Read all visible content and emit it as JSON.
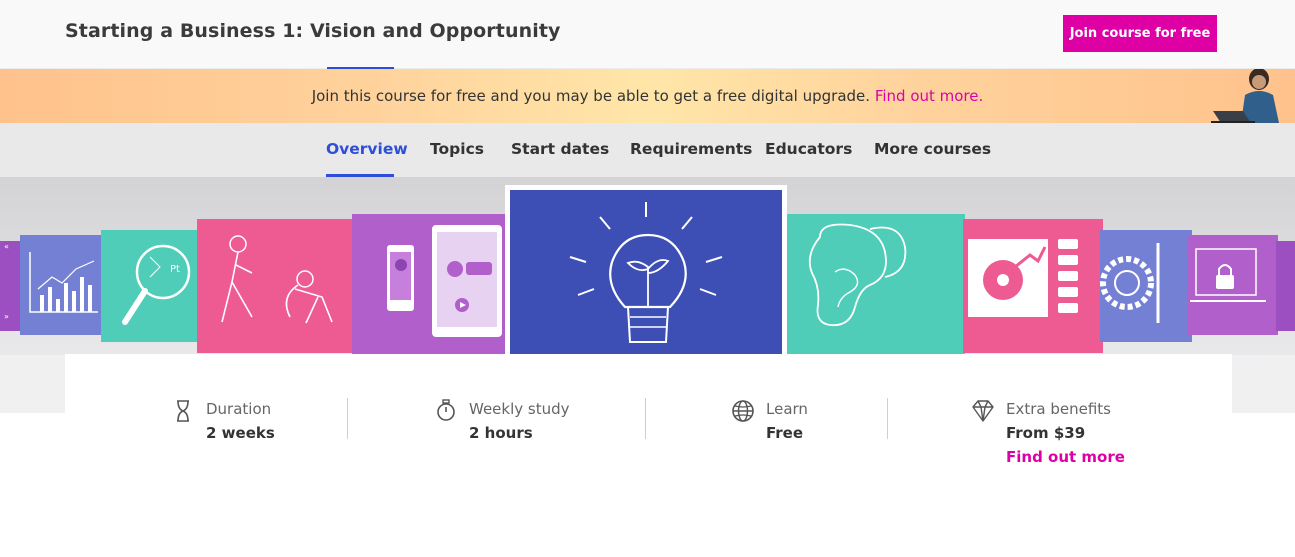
{
  "header": {
    "title": "Starting a Business 1: Vision and Opportunity",
    "join_button": "Join course for free"
  },
  "promo": {
    "text": "Join this course for free and you may be able to get a free digital upgrade. ",
    "link": "Find out more."
  },
  "tabs": [
    {
      "label": "Overview",
      "active": true
    },
    {
      "label": "Topics",
      "active": false
    },
    {
      "label": "Start dates",
      "active": false
    },
    {
      "label": "Requirements",
      "active": false
    },
    {
      "label": "Educators",
      "active": false
    },
    {
      "label": "More courses",
      "active": false
    }
  ],
  "stats": [
    {
      "icon": "hourglass-icon",
      "label": "Duration",
      "value": "2 weeks"
    },
    {
      "icon": "stopwatch-icon",
      "label": "Weekly study",
      "value": "2 hours"
    },
    {
      "icon": "globe-icon",
      "label": "Learn",
      "value": "Free"
    },
    {
      "icon": "diamond-icon",
      "label": "Extra benefits",
      "value": "From $39",
      "link": "Find out more"
    }
  ],
  "colors": {
    "accent_magenta": "#de00a5",
    "accent_blue": "#2f4ed7",
    "hero_center": "#3d4fb5",
    "pink": "#ee5a92",
    "teal": "#4fcdb9",
    "purple": "#b05fcb",
    "periwinkle": "#7480d3"
  }
}
